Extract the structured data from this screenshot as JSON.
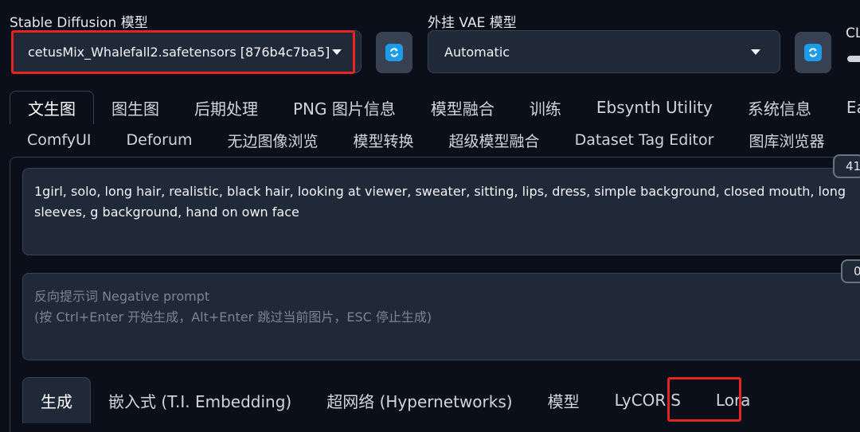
{
  "sd_model": {
    "label": "Stable Diffusion 模型",
    "value": "cetusMix_Whalefall2.safetensors [876b4c7ba5]"
  },
  "vae": {
    "label": "外挂 VAE 模型",
    "value": "Automatic"
  },
  "clip_label_partial": "CL",
  "main_tabs": [
    {
      "label": "文生图"
    },
    {
      "label": "图生图"
    },
    {
      "label": "后期处理"
    },
    {
      "label": "PNG 图片信息"
    },
    {
      "label": "模型融合"
    },
    {
      "label": "训练"
    },
    {
      "label": "Ebsynth Utility"
    },
    {
      "label": "系统信息"
    },
    {
      "label": "Ea"
    }
  ],
  "extension_tabs": [
    {
      "label": "ComfyUI"
    },
    {
      "label": "Deforum"
    },
    {
      "label": "无边图像浏览"
    },
    {
      "label": "模型转换"
    },
    {
      "label": "超级模型融合"
    },
    {
      "label": "Dataset Tag Editor"
    },
    {
      "label": "图库浏览器"
    }
  ],
  "prompt": {
    "text": "1girl, solo, long hair, realistic, black hair, looking at viewer, sweater, sitting, lips, dress, simple background, closed mouth, long sleeves, g background, hand on own face",
    "token_count": "41"
  },
  "negative_prompt": {
    "placeholder_line1": "反向提示词 Negative prompt",
    "placeholder_line2": "(按 Ctrl+Enter 开始生成，Alt+Enter 跳过当前图片，ESC 停止生成)",
    "token_count": "0"
  },
  "sub_tabs": [
    {
      "label": "生成"
    },
    {
      "label": "嵌入式 (T.I. Embedding)"
    },
    {
      "label": "超网络 (Hypernetworks)"
    },
    {
      "label": "模型"
    },
    {
      "label": "LyCORIS"
    },
    {
      "label": "Lora"
    }
  ],
  "colors": {
    "background": "#0b0f19",
    "input_bg": "#1f2937",
    "refresh_icon": "#1e9be6",
    "highlight_box": "#e3261f"
  }
}
